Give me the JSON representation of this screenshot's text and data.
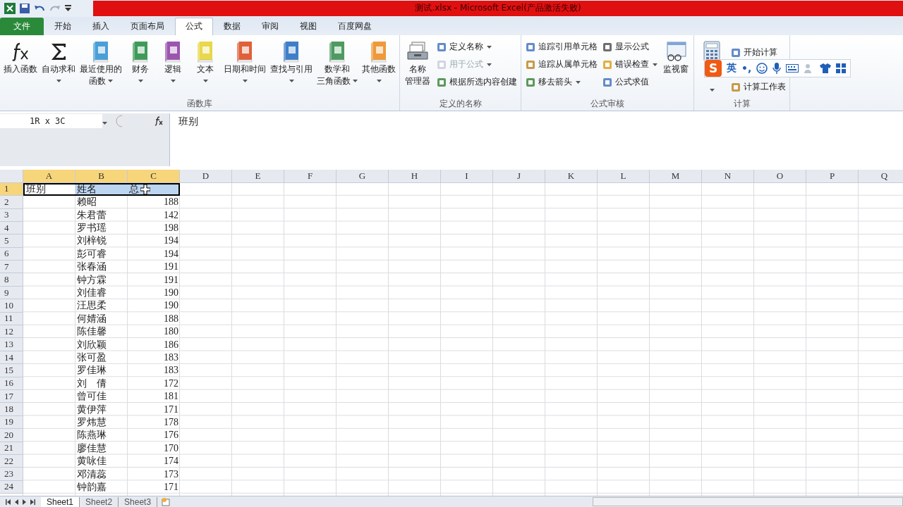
{
  "window": {
    "title": "测试.xlsx - Microsoft Excel(产品激活失败)"
  },
  "tabs": [
    {
      "label": "文件",
      "kind": "file",
      "selected": false
    },
    {
      "label": "开始",
      "kind": "tab",
      "selected": false
    },
    {
      "label": "插入",
      "kind": "tab",
      "selected": false
    },
    {
      "label": "页面布局",
      "kind": "tab",
      "selected": false
    },
    {
      "label": "公式",
      "kind": "tab",
      "selected": true
    },
    {
      "label": "数据",
      "kind": "tab",
      "selected": false
    },
    {
      "label": "审阅",
      "kind": "tab",
      "selected": false
    },
    {
      "label": "视图",
      "kind": "tab",
      "selected": false
    },
    {
      "label": "百度网盘",
      "kind": "tab",
      "selected": false
    }
  ],
  "ribbon": {
    "groups": [
      {
        "label": "函数库",
        "large": [
          {
            "kind": "fx",
            "lines": [
              "插入函数"
            ],
            "dropdown": false
          },
          {
            "kind": "sigma",
            "lines": [
              "自动求和"
            ],
            "dropdown": true
          },
          {
            "kind": "book",
            "color": "#4a9fd8",
            "lines": [
              "最近使用的",
              "函数"
            ],
            "dropdown": true
          },
          {
            "kind": "book",
            "color": "#3f9a5a",
            "lines": [
              "财务"
            ],
            "dropdown": true
          },
          {
            "kind": "book",
            "color": "#9b55b0",
            "lines": [
              "逻辑"
            ],
            "dropdown": true
          },
          {
            "kind": "book",
            "color": "#e8d84a",
            "lines": [
              "文本"
            ],
            "dropdown": true
          },
          {
            "kind": "book",
            "color": "#e0603a",
            "lines": [
              "日期和时间"
            ],
            "dropdown": true
          },
          {
            "kind": "book",
            "color": "#3f7fc8",
            "lines": [
              "查找与引用"
            ],
            "dropdown": true
          },
          {
            "kind": "book",
            "color": "#4e9a62",
            "lines": [
              "数学和",
              "三角函数"
            ],
            "dropdown": true
          },
          {
            "kind": "book",
            "color": "#ee9a3a",
            "lines": [
              "其他函数"
            ],
            "dropdown": true
          }
        ]
      },
      {
        "label": "定义的名称",
        "large": [
          {
            "kind": "names",
            "lines": [
              "名称",
              "管理器"
            ],
            "dropdown": false
          }
        ],
        "small": [
          {
            "label": "定义名称",
            "dropdown": true,
            "disabled": false
          },
          {
            "label": "用于公式",
            "dropdown": true,
            "disabled": true
          },
          {
            "label": "根据所选内容创建",
            "dropdown": false,
            "disabled": false
          }
        ]
      },
      {
        "label": "公式审核",
        "small": [
          {
            "label": "追踪引用单元格",
            "dropdown": false,
            "disabled": false
          },
          {
            "label": "追踪从属单元格",
            "dropdown": false,
            "disabled": false
          },
          {
            "label": "移去箭头",
            "dropdown": true,
            "disabled": false
          },
          {
            "label": "显示公式",
            "dropdown": false,
            "disabled": false
          },
          {
            "label": "错误检查",
            "dropdown": true,
            "disabled": false
          },
          {
            "label": "公式求值",
            "dropdown": false,
            "disabled": false
          }
        ],
        "after": [
          {
            "kind": "watch",
            "lines": [
              "监视窗"
            ],
            "dropdown": false
          }
        ]
      },
      {
        "label": "计算",
        "large": [
          {
            "kind": "calc",
            "dropdown": true
          }
        ],
        "small": [
          {
            "label": "开始计算",
            "dropdown": false,
            "disabled": false
          },
          {
            "label": "计算工作表",
            "dropdown": false,
            "disabled": false
          }
        ]
      }
    ]
  },
  "ime": {
    "logo": "S",
    "mode": "英",
    "punct": "•,"
  },
  "formula_bar": {
    "name_box": "1R x 3C",
    "value": "班别"
  },
  "sheet": {
    "columns": [
      {
        "label": "A",
        "selected": true
      },
      {
        "label": "B",
        "selected": true
      },
      {
        "label": "C",
        "selected": true
      },
      {
        "label": "D",
        "selected": false
      },
      {
        "label": "E",
        "selected": false
      },
      {
        "label": "F",
        "selected": false
      },
      {
        "label": "G",
        "selected": false
      },
      {
        "label": "H",
        "selected": false
      },
      {
        "label": "I",
        "selected": false
      },
      {
        "label": "J",
        "selected": false
      },
      {
        "label": "K",
        "selected": false
      },
      {
        "label": "L",
        "selected": false
      },
      {
        "label": "M",
        "selected": false
      },
      {
        "label": "N",
        "selected": false
      },
      {
        "label": "O",
        "selected": false
      },
      {
        "label": "P",
        "selected": false
      },
      {
        "label": "Q",
        "selected": false
      }
    ],
    "rows": [
      {
        "number": "1",
        "selected": true,
        "cells": [
          "班别",
          "姓名",
          "总"
        ]
      },
      {
        "number": "2",
        "selected": false,
        "cells": [
          "",
          "赖昭",
          "188"
        ]
      },
      {
        "number": "3",
        "selected": false,
        "cells": [
          "",
          "朱君蕾",
          "142"
        ]
      },
      {
        "number": "4",
        "selected": false,
        "cells": [
          "",
          "罗书瑶",
          "198"
        ]
      },
      {
        "number": "5",
        "selected": false,
        "cells": [
          "",
          "刘梓锐",
          "194"
        ]
      },
      {
        "number": "6",
        "selected": false,
        "cells": [
          "",
          "彭可睿",
          "194"
        ]
      },
      {
        "number": "7",
        "selected": false,
        "cells": [
          "",
          "张春涵",
          "191"
        ]
      },
      {
        "number": "8",
        "selected": false,
        "cells": [
          "",
          "钟方霖",
          "191"
        ]
      },
      {
        "number": "9",
        "selected": false,
        "cells": [
          "",
          "刘佳睿",
          "190"
        ]
      },
      {
        "number": "10",
        "selected": false,
        "cells": [
          "",
          "汪思柔",
          "190"
        ]
      },
      {
        "number": "11",
        "selected": false,
        "cells": [
          "",
          "何婧涵",
          "188"
        ]
      },
      {
        "number": "12",
        "selected": false,
        "cells": [
          "",
          "陈佳馨",
          "180"
        ]
      },
      {
        "number": "13",
        "selected": false,
        "cells": [
          "",
          "刘欣颖",
          "186"
        ]
      },
      {
        "number": "14",
        "selected": false,
        "cells": [
          "",
          "张可盈",
          "183"
        ]
      },
      {
        "number": "15",
        "selected": false,
        "cells": [
          "",
          "罗佳琳",
          "183"
        ]
      },
      {
        "number": "16",
        "selected": false,
        "cells": [
          "",
          "刘　倩",
          "172"
        ]
      },
      {
        "number": "17",
        "selected": false,
        "cells": [
          "",
          "曾可佳",
          "181"
        ]
      },
      {
        "number": "18",
        "selected": false,
        "cells": [
          "",
          "黄伊萍",
          "171"
        ]
      },
      {
        "number": "19",
        "selected": false,
        "cells": [
          "",
          "罗炜慧",
          "178"
        ]
      },
      {
        "number": "20",
        "selected": false,
        "cells": [
          "",
          "陈燕琳",
          "176"
        ]
      },
      {
        "number": "21",
        "selected": false,
        "cells": [
          "",
          "廖佳慧",
          "170"
        ]
      },
      {
        "number": "22",
        "selected": false,
        "cells": [
          "",
          "黄咏佳",
          "174"
        ]
      },
      {
        "number": "23",
        "selected": false,
        "cells": [
          "",
          "邓清蕊",
          "173"
        ]
      },
      {
        "number": "24",
        "selected": false,
        "cells": [
          "",
          "钟韵嘉",
          "171"
        ]
      }
    ]
  },
  "sheet_tabs": [
    {
      "label": "Sheet1",
      "selected": true
    },
    {
      "label": "Sheet2",
      "selected": false
    },
    {
      "label": "Sheet3",
      "selected": false
    }
  ]
}
